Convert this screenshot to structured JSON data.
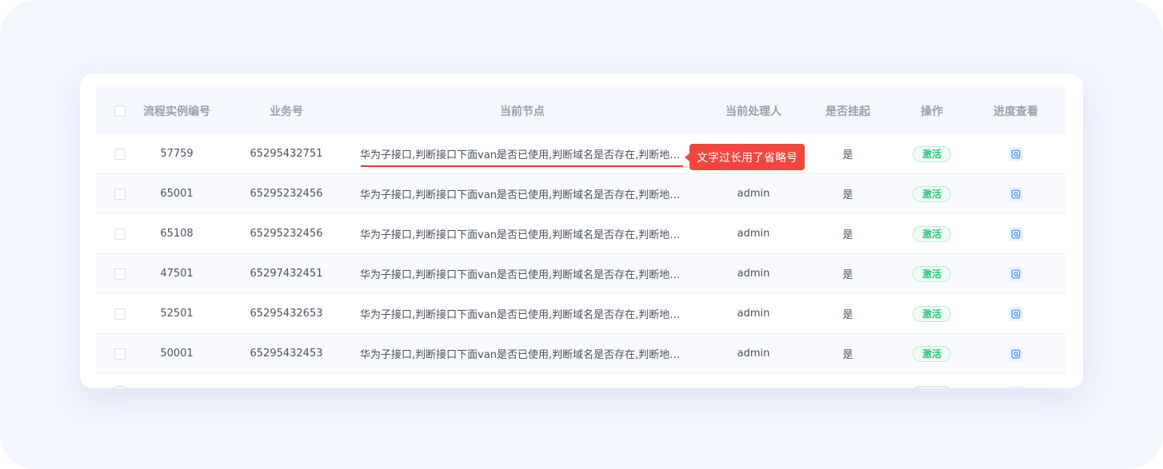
{
  "table": {
    "headers": {
      "select": "",
      "instance_id": "流程实例编号",
      "business_no": "业务号",
      "current_node": "当前节点",
      "handler": "当前处理人",
      "suspended": "是否挂起",
      "operation": "操作",
      "progress": "进度查看"
    },
    "rows": [
      {
        "instance_id": "57759",
        "business_no": "65295432751",
        "current_node": "华为子接口,判断接口下面van是否已使用,判断域名是否存在,判断地址...",
        "handler": "",
        "suspended": "是",
        "operation": "激活"
      },
      {
        "instance_id": "65001",
        "business_no": "65295232456",
        "current_node": "华为子接口,判断接口下面van是否已使用,判断域名是否存在,判断地址...",
        "handler": "admin",
        "suspended": "是",
        "operation": "激活"
      },
      {
        "instance_id": "65108",
        "business_no": "65295232456",
        "current_node": "华为子接口,判断接口下面van是否已使用,判断域名是否存在,判断地址...",
        "handler": "admin",
        "suspended": "是",
        "operation": "激活"
      },
      {
        "instance_id": "47501",
        "business_no": "65297432451",
        "current_node": "华为子接口,判断接口下面van是否已使用,判断域名是否存在,判断地址...",
        "handler": "admin",
        "suspended": "是",
        "operation": "激活"
      },
      {
        "instance_id": "52501",
        "business_no": "65295432653",
        "current_node": "华为子接口,判断接口下面van是否已使用,判断域名是否存在,判断地址...",
        "handler": "admin",
        "suspended": "是",
        "operation": "激活"
      },
      {
        "instance_id": "50001",
        "business_no": "65295432453",
        "current_node": "华为子接口,判断接口下面van是否已使用,判断域名是否存在,判断地址...",
        "handler": "admin",
        "suspended": "是",
        "operation": "激活"
      }
    ]
  },
  "tooltip": {
    "text": "文字过长用了省略号"
  },
  "icons": {
    "progress": "search-document-icon"
  },
  "colors": {
    "tooltip_bg": "#f2453d",
    "underline": "#e8393a",
    "badge_text": "#32c27f",
    "badge_border": "#b9ecd5",
    "progress_icon": "#3f8ff5"
  }
}
